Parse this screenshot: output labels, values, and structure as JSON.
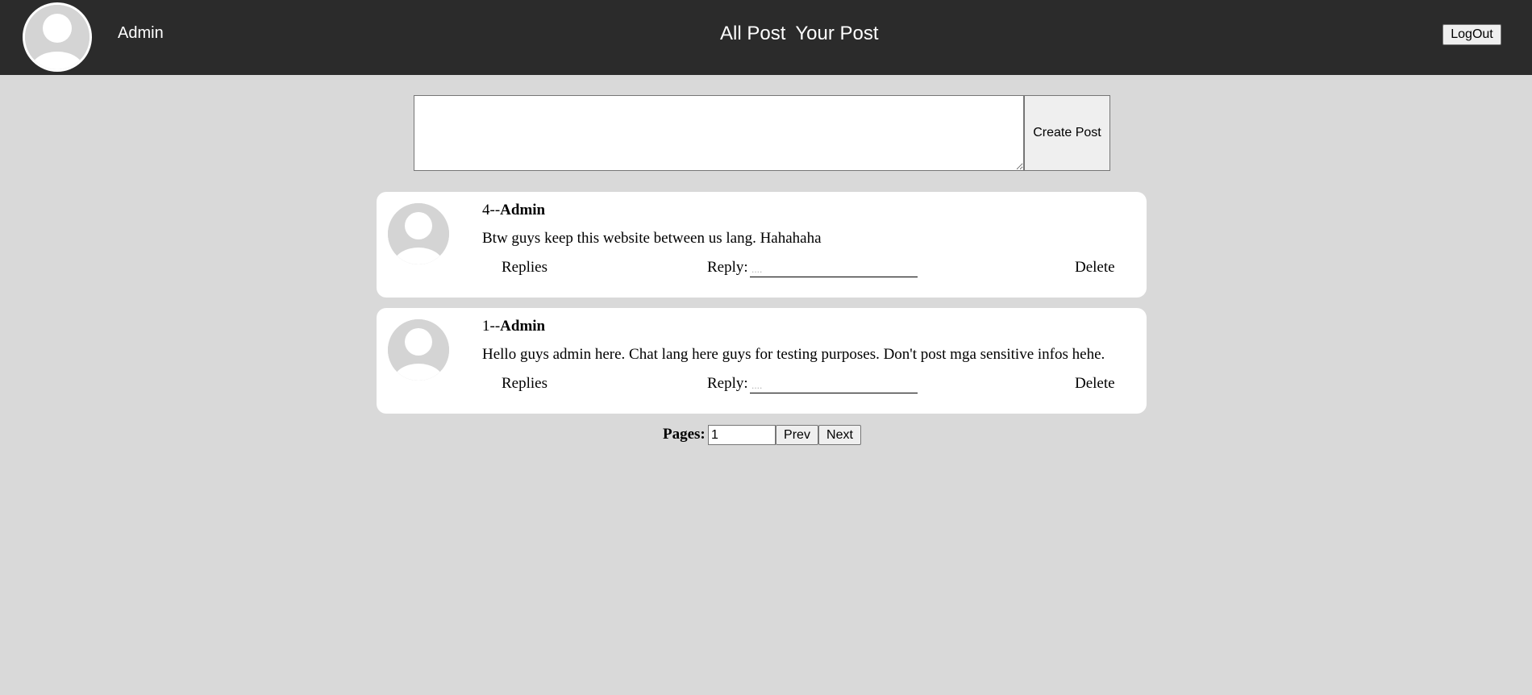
{
  "header": {
    "username": "Admin",
    "nav": {
      "all_post": "All Post",
      "your_post": "Your Post"
    },
    "logout_label": "LogOut"
  },
  "composer": {
    "text_value": "",
    "create_label": "Create Post"
  },
  "posts": [
    {
      "id_prefix": "4--",
      "author": "Admin",
      "body": "Btw guys keep this website between us lang. Hahahaha",
      "replies_label": "Replies",
      "reply_label": "Reply:",
      "reply_placeholder": "....",
      "delete_label": "Delete"
    },
    {
      "id_prefix": "1--",
      "author": "Admin",
      "body": "Hello guys admin here. Chat lang here guys for testing purposes. Don't post mga sensitive infos hehe.",
      "replies_label": "Replies",
      "reply_label": "Reply:",
      "reply_placeholder": "....",
      "delete_label": "Delete"
    }
  ],
  "pagination": {
    "label": "Pages:",
    "current_page": "1",
    "prev_label": "Prev",
    "next_label": "Next"
  },
  "colors": {
    "header_bg": "#2b2b2b",
    "page_bg": "#d9d9d9",
    "card_bg": "#ffffff",
    "avatar_bg": "#d4d4d4"
  },
  "icons": {
    "avatar": "user-silhouette-icon"
  }
}
